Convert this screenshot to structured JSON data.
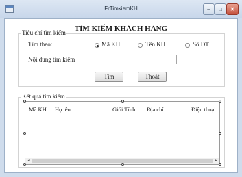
{
  "window": {
    "title": "FrTimkiemKH"
  },
  "titlebar_controls": {
    "minimize": "–",
    "maximize": "□",
    "close": "✕"
  },
  "heading": "TÌM KIẾM KHÁCH HÀNG",
  "criteria": {
    "legend": "Tiêu chí tìm kiếm",
    "search_by_label": "Tìm theo:",
    "options": [
      {
        "label": "Mã KH",
        "checked": true
      },
      {
        "label": "Tên KH",
        "checked": false
      },
      {
        "label": "Số ĐT",
        "checked": false
      }
    ],
    "content_label": "Nội dung tìm kiếm",
    "content_value": "",
    "find_button": "Tìm",
    "exit_button": "Thoát"
  },
  "results": {
    "legend": "Kết quả tìm kiếm",
    "columns": [
      "Mã KH",
      "Họ tên",
      "Giới Tính",
      "Địa chỉ",
      "Điện thoại"
    ],
    "rows": []
  },
  "icons": {
    "scroll_left": "◂",
    "scroll_right": "▸"
  }
}
